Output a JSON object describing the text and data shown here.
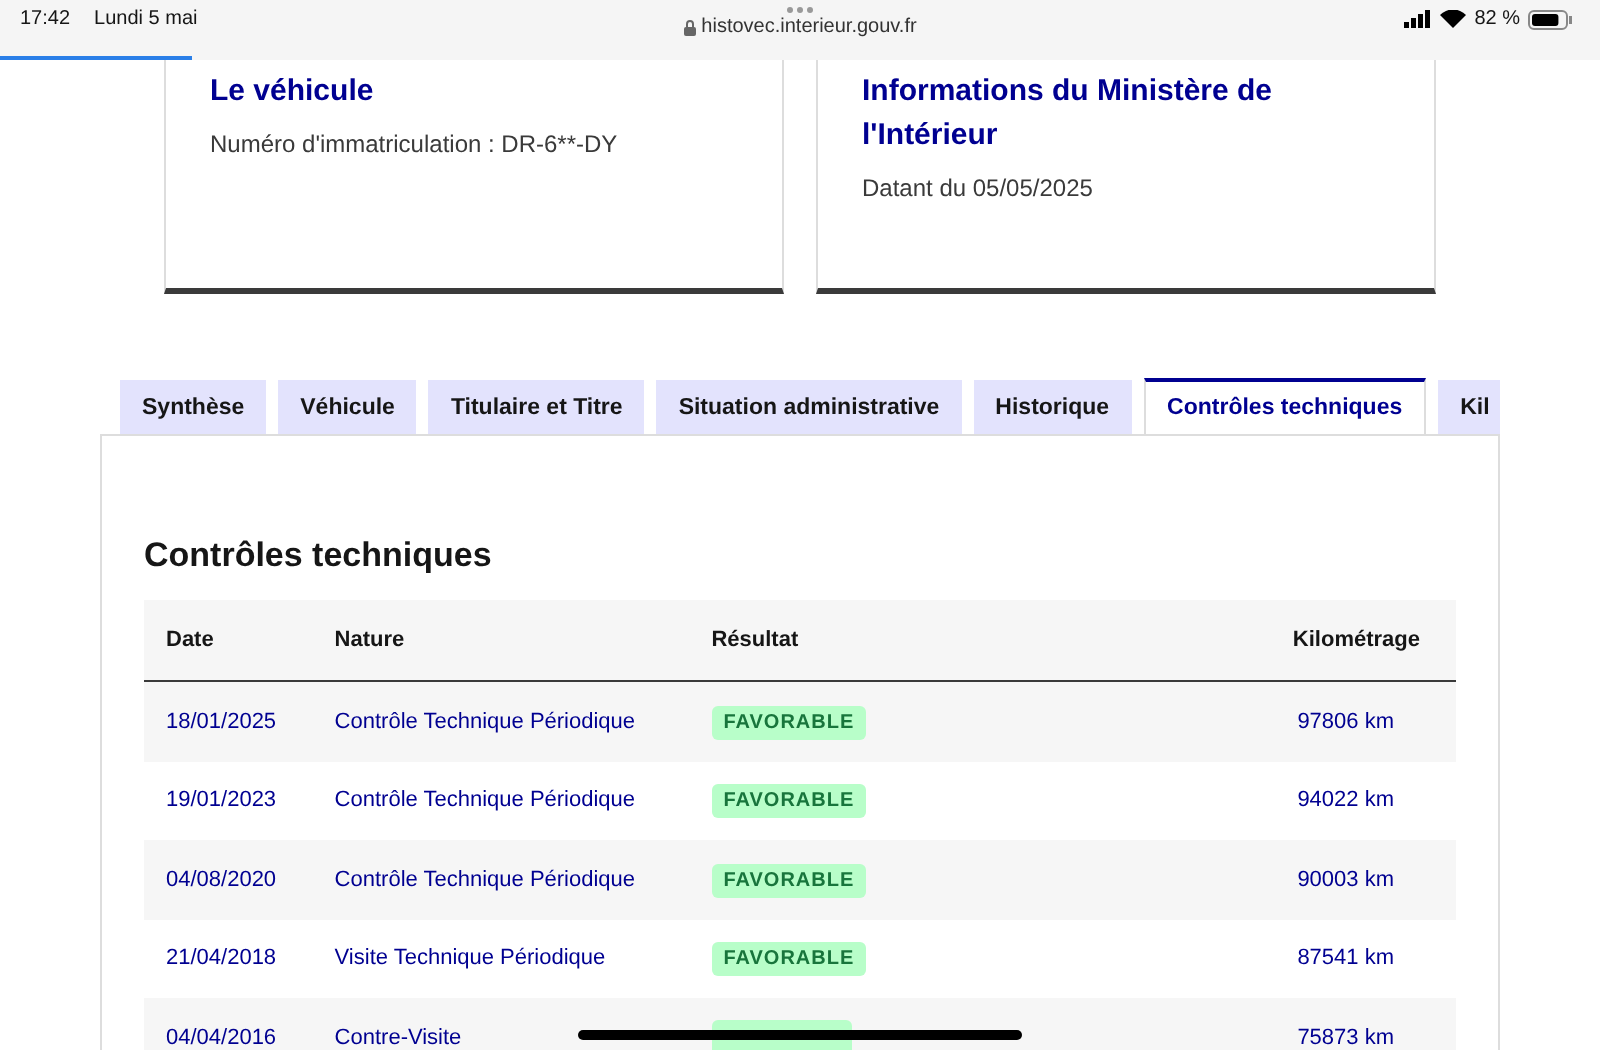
{
  "status_bar": {
    "time": "17:42",
    "date": "Lundi 5 mai",
    "url": "histovec.interieur.gouv.fr",
    "battery": "82 %",
    "load_progress": {
      "level": 0.12
    }
  },
  "cards": [
    {
      "title": "Le véhicule",
      "text": "Numéro d'immatriculation : DR-6**-DY"
    },
    {
      "title": "Informations du Ministère de l'Intérieur",
      "text": "Datant du 05/05/2025"
    }
  ],
  "tabs": [
    {
      "label": "Synthèse",
      "selected": false
    },
    {
      "label": "Véhicule",
      "selected": false
    },
    {
      "label": "Titulaire et Titre",
      "selected": false
    },
    {
      "label": "Situation administrative",
      "selected": false
    },
    {
      "label": "Historique",
      "selected": false
    },
    {
      "label": "Contrôles techniques",
      "selected": true
    },
    {
      "label": "Kil",
      "selected": false
    }
  ],
  "section_title": "Contrôles techniques",
  "table": {
    "columns": [
      "Date",
      "Nature",
      "Résultat",
      "Kilométrage"
    ],
    "rows": [
      {
        "date": "18/01/2025",
        "nature": "Contrôle Technique Périodique",
        "result": "FAVORABLE",
        "mileage": "97806 km"
      },
      {
        "date": "19/01/2023",
        "nature": "Contrôle Technique Périodique",
        "result": "FAVORABLE",
        "mileage": "94022 km"
      },
      {
        "date": "04/08/2020",
        "nature": "Contrôle Technique Périodique",
        "result": "FAVORABLE",
        "mileage": "90003 km"
      },
      {
        "date": "21/04/2018",
        "nature": "Visite Technique Périodique",
        "result": "FAVORABLE",
        "mileage": "87541 km"
      },
      {
        "date": "04/04/2016",
        "nature": "Contre-Visite",
        "mileage": "75873 km"
      }
    ]
  }
}
